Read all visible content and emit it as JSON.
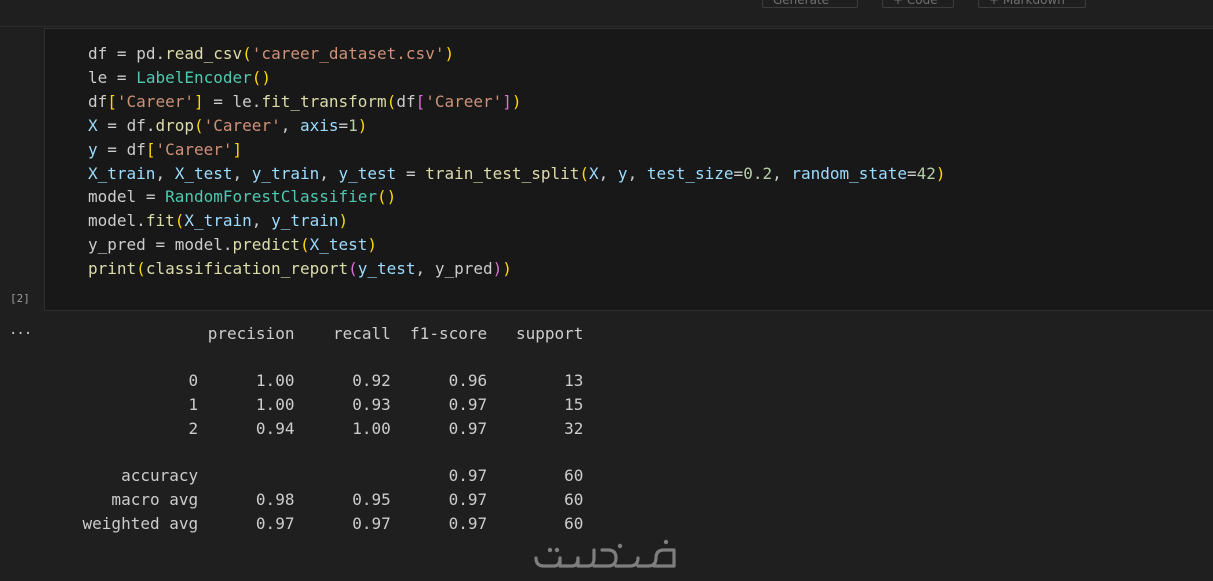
{
  "toolbar": {
    "generate_label": "Generate",
    "code_label": "+ Code",
    "markdown_label": "+ Markdown"
  },
  "cell": {
    "execution_count": "[2]",
    "code_lines": [
      "df = pd.read_csv('career_dataset.csv')",
      "le = LabelEncoder()",
      "df['Career'] = le.fit_transform(df['Career'])",
      "X = df.drop('Career', axis=1)",
      "y = df['Career']",
      "X_train, X_test, y_train, y_test = train_test_split(X, y, test_size=0.2, random_state=42)",
      "model = RandomForestClassifier()",
      "model.fit(X_train, y_train)",
      "y_pred = model.predict(X_test)",
      "print(classification_report(y_test, y_pred))"
    ]
  },
  "output": {
    "ellipsis": "...",
    "report": {
      "columns": [
        "precision",
        "recall",
        "f1-score",
        "support"
      ],
      "rows": [
        {
          "label": "0",
          "precision": "1.00",
          "recall": "0.92",
          "f1": "0.96",
          "support": "13"
        },
        {
          "label": "1",
          "precision": "1.00",
          "recall": "0.93",
          "f1": "0.97",
          "support": "15"
        },
        {
          "label": "2",
          "precision": "0.94",
          "recall": "1.00",
          "f1": "0.97",
          "support": "32"
        }
      ],
      "summary": [
        {
          "label": "accuracy",
          "precision": "",
          "recall": "",
          "f1": "0.97",
          "support": "60"
        },
        {
          "label": "macro avg",
          "precision": "0.98",
          "recall": "0.95",
          "f1": "0.97",
          "support": "60"
        },
        {
          "label": "weighted avg",
          "precision": "0.97",
          "recall": "0.97",
          "f1": "0.97",
          "support": "60"
        }
      ]
    }
  },
  "watermark": {
    "icon": "khamsat-logo-icon",
    "text": "خمسات"
  }
}
